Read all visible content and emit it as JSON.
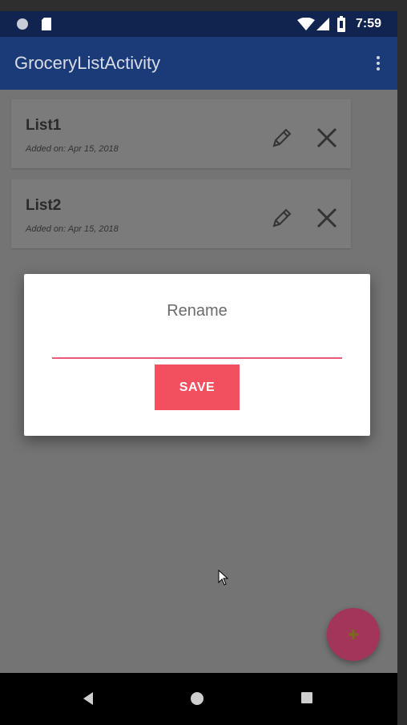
{
  "status_bar": {
    "time": "7:59",
    "icons": [
      "notification-dot-icon",
      "sd-card-icon",
      "wifi-icon",
      "signal-icon",
      "battery-icon"
    ]
  },
  "app_bar": {
    "title": "GroceryListActivity",
    "overflow_icon": "more-vert-icon"
  },
  "lists": [
    {
      "name": "List1",
      "added": "Added on: Apr 15, 2018",
      "edit_icon": "pencil-icon",
      "delete_icon": "close-icon"
    },
    {
      "name": "List2",
      "added": "Added on: Apr 15, 2018",
      "edit_icon": "pencil-icon",
      "delete_icon": "close-icon"
    }
  ],
  "dialog": {
    "title": "Rename",
    "input_value": "",
    "save_label": "SAVE"
  },
  "fab": {
    "icon": "plus-icon"
  },
  "nav_bar": {
    "icons": [
      "back-icon",
      "home-icon",
      "recents-icon"
    ]
  },
  "colors": {
    "app_bar": "#1b3a78",
    "status_bar": "#10244f",
    "accent": "#e85a78",
    "save_button": "#f2505e",
    "fab": "#a3355a",
    "scrim": "#747474"
  }
}
